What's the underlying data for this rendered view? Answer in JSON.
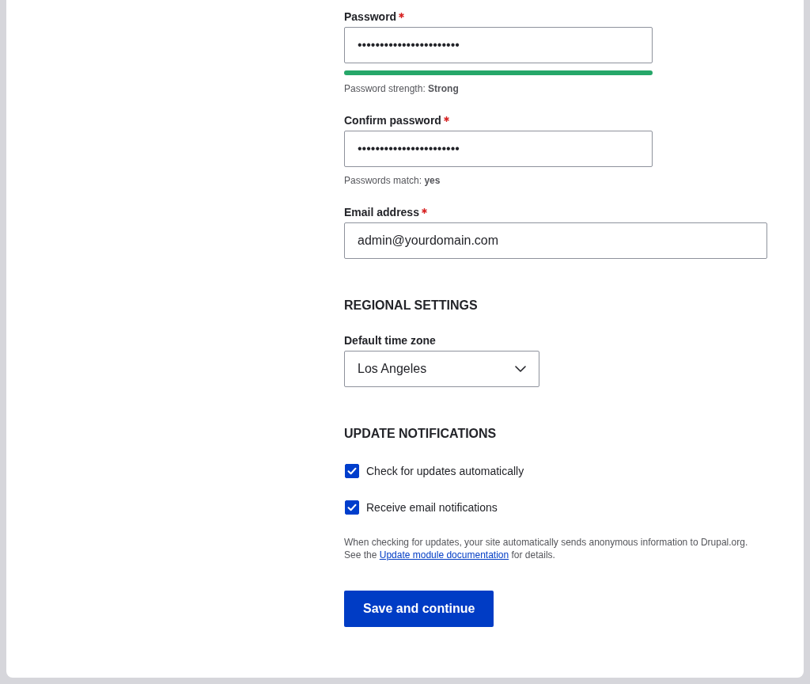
{
  "fields": [
    {
      "kind": "password",
      "label": "Password",
      "required": true,
      "value": "•••••••••••••••••••••••",
      "level": 1,
      "help": "Password strength: **Strong**"
    },
    {
      "kind": "password",
      "label": "Confirm password",
      "required": true,
      "value": "•••••••••••••••••••••••",
      "help": "Passwords match: **yes**"
    },
    {
      "kind": "email",
      "label": "Email address",
      "required": true,
      "value": "admin@yourdomain.com"
    }
  ],
  "regional_settings": {
    "heading": "REGIONAL SETTINGS",
    "time_zone": {
      "label": "Default time zone",
      "value": "Los Angeles"
    }
  },
  "update_notifications": {
    "heading": "UPDATE NOTIFICATIONS",
    "checkboxes": [
      {
        "label": "Check for updates automatically",
        "checked": true
      },
      {
        "label": "Receive email notifications",
        "checked": true
      }
    ],
    "description": {
      "text": "When checking for updates, your site automatically sends anonymous information to Drupal.org.",
      "link_prefix": "See the",
      "link": "Update module documentation",
      "link_suffix": "for details."
    }
  },
  "submit_button": "Save and continue"
}
